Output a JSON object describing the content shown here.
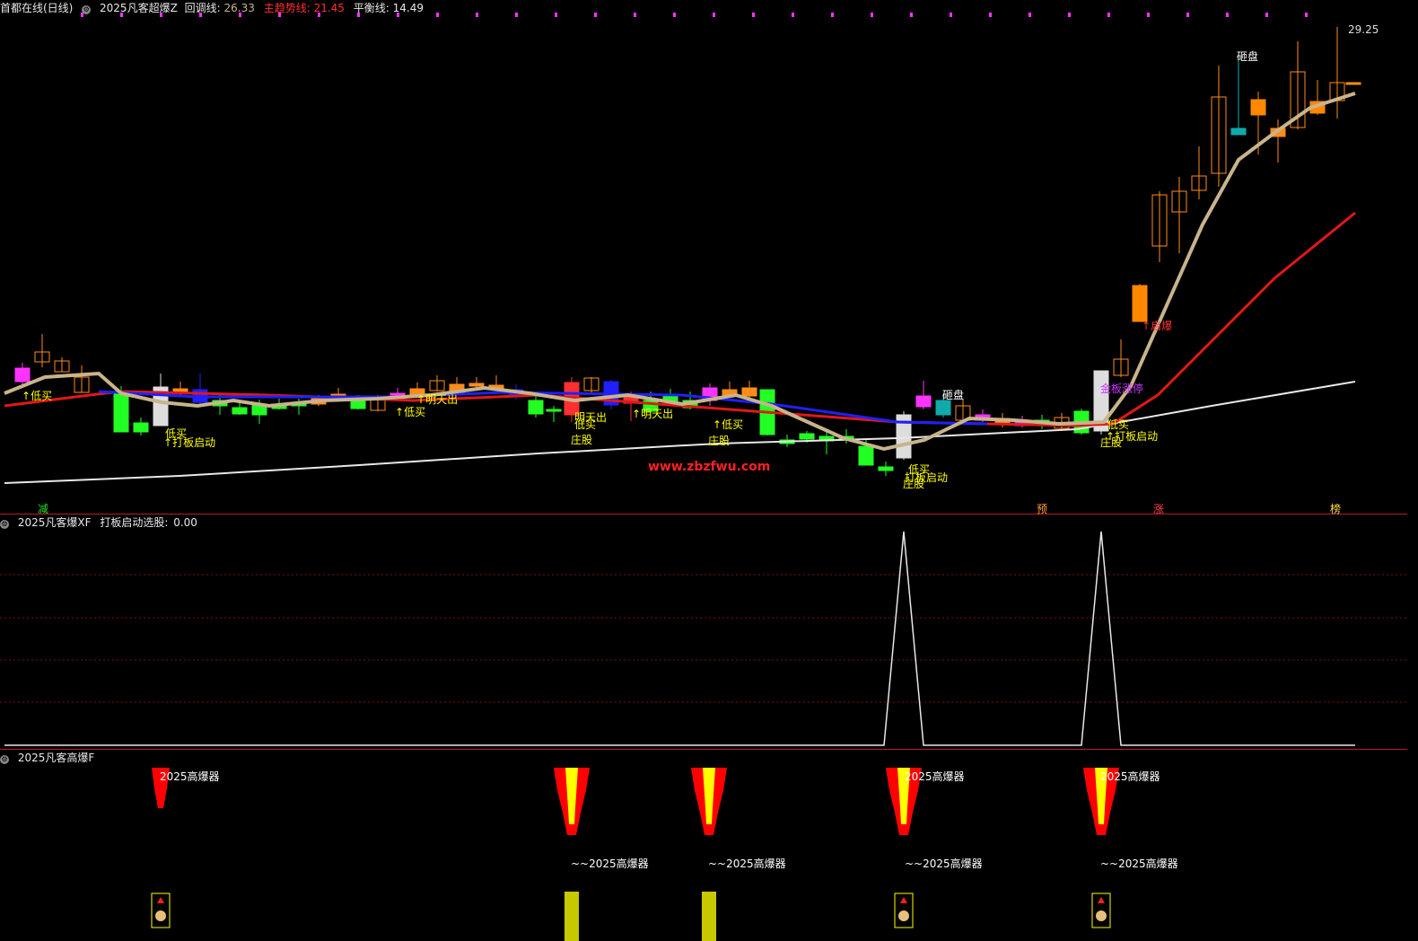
{
  "header": {
    "app_title": "首都在线(日线)",
    "indicator_name": "2025凡客超爆Z",
    "retrace_label": "回调线:",
    "retrace_value": "26.33",
    "trend_label": "主趋势线:",
    "trend_value": "21.45",
    "balance_label": "平衡线:",
    "balance_value": "14.49"
  },
  "price_high_label": "29.25",
  "watermark": "www.zbzfwu.com",
  "panel2": {
    "name": "2025凡客爆XF",
    "series_label": "打板启动选股:",
    "series_value": "0.00"
  },
  "panel3": {
    "name": "2025凡客高爆F"
  },
  "bottom_markers": [
    {
      "text": "减",
      "color": "#22dd22"
    },
    {
      "text": "预",
      "color": "#ff9933"
    },
    {
      "text": "涨",
      "color": "#ff4444"
    },
    {
      "text": "榜",
      "color": "#ffdd44"
    }
  ],
  "signal_labels": {
    "low_buy": "低买",
    "start": "打板启动",
    "sell_tomorrow": "明天出",
    "dealer": "庄股",
    "smash": "砸盘",
    "launch": "启爆",
    "board": "金板涨停",
    "high_burst": "2025高爆器",
    "high_burst_tilde": "~~2025高爆器"
  },
  "colors": {
    "up": "#ff8c1a",
    "down": "#22ff22",
    "retrace_line": "#c8b48c",
    "trend_line": "#e01818",
    "balance_line": "#e8e8e8",
    "blue_line": "#2020ff",
    "signal_text": "#ffff00"
  },
  "chart_data": [
    {
      "type": "candlestick",
      "title": "2025凡客超爆Z",
      "series": [
        {
          "name": "回调线",
          "last": 26.33
        },
        {
          "name": "主趋势线",
          "last": 21.45
        },
        {
          "name": "平衡线",
          "last": 14.49
        }
      ],
      "max_price": 29.25,
      "markers": [
        "低买",
        "打板启动",
        "明天出",
        "庄股",
        "砸盘",
        "启爆",
        "金板涨停"
      ]
    },
    {
      "type": "line",
      "title": "2025凡客爆XF",
      "series": [
        {
          "name": "打板启动选股",
          "last": 0.0
        }
      ],
      "spikes_at_index": [
        45,
        55
      ]
    },
    {
      "type": "bar",
      "title": "2025凡客高爆F",
      "markers": [
        "2025高爆器",
        "~~2025高爆器"
      ]
    }
  ]
}
